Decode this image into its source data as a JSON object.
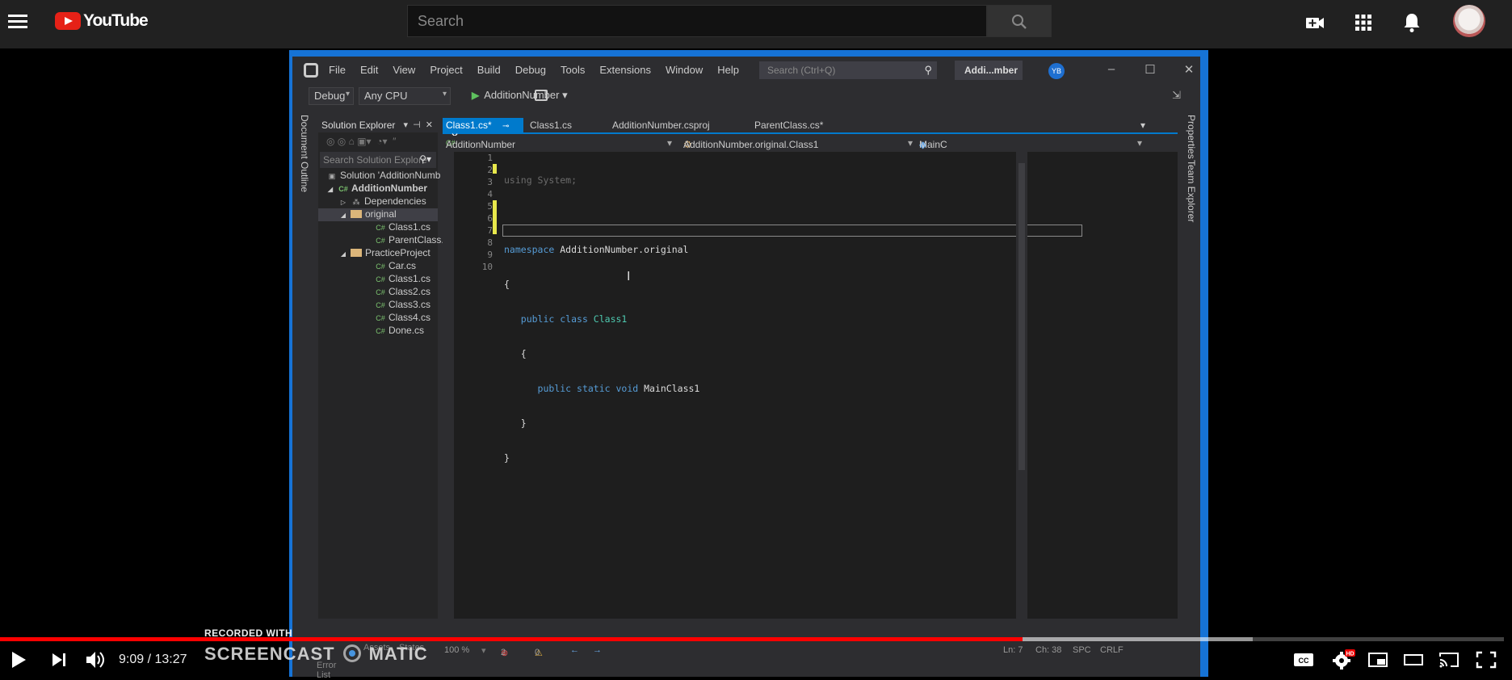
{
  "youtube": {
    "logo_text": "YouTube",
    "search_placeholder": "Search"
  },
  "player": {
    "current_time": "9:09",
    "duration": "13:27",
    "time_display": "9:09 / 13:27",
    "progress_played": 0.68,
    "progress_loaded": 0.833,
    "accent": "#ff0000"
  },
  "watermark": {
    "line1": "RECORDED WITH",
    "line2_left": "SCREENCAST",
    "line2_right": "MATIC"
  },
  "vs": {
    "menu": [
      "File",
      "Edit",
      "View",
      "Project",
      "Build",
      "Debug",
      "Tools",
      "Extensions",
      "Window",
      "Help"
    ],
    "quick_search": "Search (Ctrl+Q)",
    "app_name": "Addi...mber",
    "user_initials": "YB",
    "toolbar": {
      "config": "Debug",
      "platform": "Any CPU",
      "run_target": "AdditionNumber"
    },
    "left_strip_label": "Document Outline",
    "right_strip_labels": [
      "Properties",
      "Team Explorer"
    ],
    "solution_explorer": {
      "title": "Solution Explorer",
      "search_placeholder": "Search Solution Explore",
      "tree": [
        "Solution 'AdditionNumb",
        "AdditionNumber",
        "Dependencies",
        "original",
        "Class1.cs",
        "ParentClass.cs",
        "PracticeProject",
        "Car.cs",
        "Class1.cs",
        "Class2.cs",
        "Class3.cs",
        "Class4.cs",
        "Done.cs"
      ]
    },
    "tabs": [
      "Class1.cs*",
      "Class1.cs",
      "AdditionNumber.csproj",
      "ParentClass.cs*"
    ],
    "nav": {
      "project": "AdditionNumber",
      "class": "AdditionNumber.original.Class1",
      "member": "MainC"
    },
    "line_numbers": [
      "1",
      "2",
      "3",
      "4",
      "5",
      "6",
      "7",
      "8",
      "9",
      "10"
    ],
    "code": {
      "l1_kw": "using",
      "l1_rest": " System;",
      "l3_kw": "namespace",
      "l3_rest": " AdditionNumber.original",
      "l4": "{",
      "l5_kw1": "public",
      "l5_kw2": " class",
      "l5_name": " Class1",
      "l6": "{",
      "l7_kw1": "public",
      "l7_kw2": " static",
      "l7_kw3": " void",
      "l7_name": " MainClass1",
      "l8": "}",
      "l9": "}"
    },
    "status": {
      "zoom": "100 %",
      "errors": "2",
      "warnings": "0",
      "line": "Ln: 7",
      "col": "Ch: 38",
      "spc": "SPC",
      "crlf": "CRLF",
      "tab_assets": "Assets",
      "tab_states": "States",
      "error_list": "Error List"
    }
  }
}
